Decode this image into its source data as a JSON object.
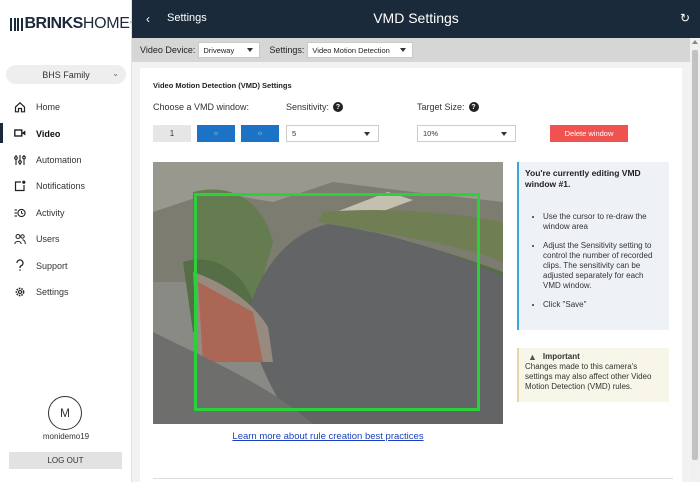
{
  "sidebar": {
    "logo": {
      "brand": "BRINKS",
      "suffix": "HOME",
      "tm": "™"
    },
    "account_select": "BHS Family",
    "items": [
      {
        "label": "Home",
        "icon": "home-icon"
      },
      {
        "label": "Video",
        "icon": "video-camera-icon",
        "active": true
      },
      {
        "label": "Automation",
        "icon": "sliders-icon"
      },
      {
        "label": "Notifications",
        "icon": "notification-icon"
      },
      {
        "label": "Activity",
        "icon": "activity-list-icon"
      },
      {
        "label": "Users",
        "icon": "users-icon"
      },
      {
        "label": "Support",
        "icon": "support-hook-icon"
      },
      {
        "label": "Settings",
        "icon": "gear-icon"
      }
    ],
    "avatar_initial": "M",
    "username": "monidemo19",
    "logout_label": "LOG OUT"
  },
  "header": {
    "back_label": "Settings",
    "title": "VMD Settings"
  },
  "toolbar": {
    "device_label": "Video Device:",
    "device_value": "Driveway",
    "settings_label": "Settings:",
    "settings_value": "Video Motion Detection"
  },
  "vmd": {
    "section_title": "Video Motion Detection (VMD) Settings",
    "choose_label": "Choose a VMD window:",
    "window_1": "1",
    "window_2": "☼",
    "window_3": "☼",
    "sensitivity_label": "Sensitivity:",
    "sensitivity_value": "5",
    "target_label": "Target Size:",
    "target_value": "10%",
    "delete_label": "Delete window",
    "learn_link": "Learn more about rule creation best practices"
  },
  "info": {
    "heading": "You're currently editing VMD window #1.",
    "bullets": [
      "Use the cursor to re-draw the window area",
      "Adjust the Sensitivity setting to control the number of recorded clips. The sensitivity can be adjusted separately for each VMD window.",
      "Click \"Save\""
    ]
  },
  "important": {
    "title": "Important",
    "text": "Changes made to this camera's settings may also affect other Video Motion Detection (VMD) rules."
  },
  "colors": {
    "header_bg": "#1b2a3a",
    "accent_blue": "#1c72c4",
    "delete_red": "#f0524f",
    "vmd_green": "#2bd13a",
    "info_border": "#3aa6d8"
  }
}
